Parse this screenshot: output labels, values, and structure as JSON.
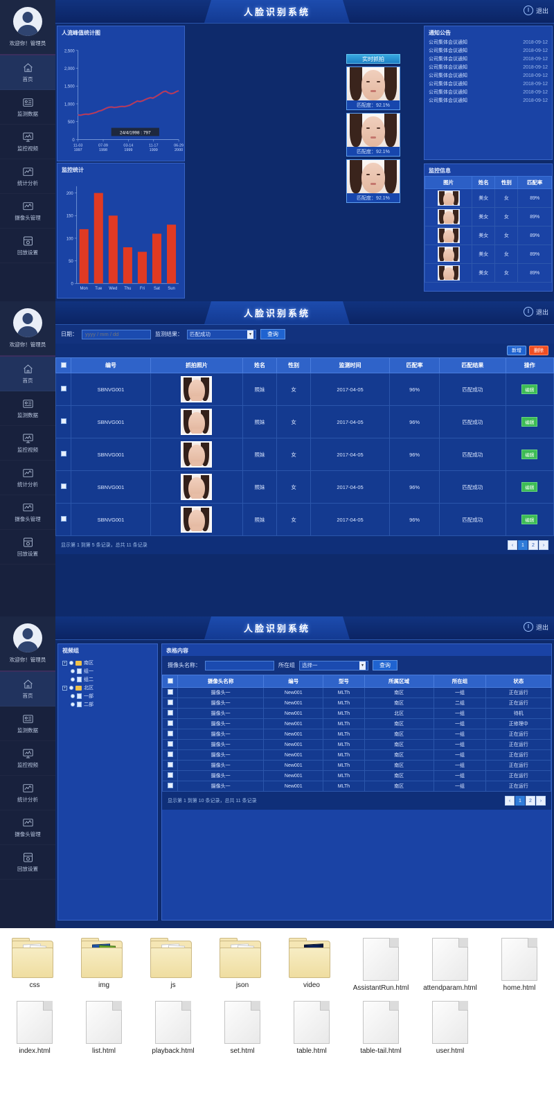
{
  "app": {
    "title": "人脸识别系统",
    "logout_label": "退出"
  },
  "sidebar": {
    "welcome": "欢迎你！管理员",
    "items": [
      {
        "label": "首页",
        "icon": "home-icon"
      },
      {
        "label": "监测数据",
        "icon": "data-monitor-icon"
      },
      {
        "label": "监控视频",
        "icon": "video-monitor-icon"
      },
      {
        "label": "统计分析",
        "icon": "statistics-icon"
      },
      {
        "label": "摄像头管理",
        "icon": "camera-manage-icon"
      },
      {
        "label": "回放设置",
        "icon": "playback-settings-icon"
      }
    ]
  },
  "dashboard": {
    "live": {
      "header": "实时抓拍",
      "cards": [
        {
          "match": "匹配度：92.1%"
        },
        {
          "match": "匹配度：92.1%"
        },
        {
          "match": "匹配度：92.1%"
        }
      ]
    },
    "notice": {
      "title": "通知公告",
      "rows": [
        {
          "text": "公司集体会议通知",
          "date": "2018-09-12"
        },
        {
          "text": "公司集体会议通知",
          "date": "2018-09-12"
        },
        {
          "text": "公司集体会议通知",
          "date": "2018-09-12"
        },
        {
          "text": "公司集体会议通知",
          "date": "2018-09-12"
        },
        {
          "text": "公司集体会议通知",
          "date": "2018-09-12"
        },
        {
          "text": "公司集体会议通知",
          "date": "2018-09-12"
        },
        {
          "text": "公司集体会议通知",
          "date": "2018-09-12"
        },
        {
          "text": "公司集体会议通知",
          "date": "2018-09-12"
        }
      ]
    },
    "monitor": {
      "title": "监控信息",
      "columns": [
        "图片",
        "姓名",
        "性别",
        "匹配率"
      ],
      "rows": [
        {
          "name": "美女",
          "gender": "女",
          "rate": "89%"
        },
        {
          "name": "美女",
          "gender": "女",
          "rate": "89%"
        },
        {
          "name": "美女",
          "gender": "女",
          "rate": "89%"
        },
        {
          "name": "美女",
          "gender": "女",
          "rate": "89%"
        },
        {
          "name": "美女",
          "gender": "女",
          "rate": "89%"
        }
      ]
    }
  },
  "chart_data": [
    {
      "type": "line",
      "title": "人流峰值统计图",
      "xlabel": "",
      "ylabel": "",
      "ylim": [
        0,
        2500
      ],
      "yticks": [
        0,
        500,
        1000,
        1500,
        2000,
        2500
      ],
      "ytick_labels": [
        "0",
        "500",
        "1,000",
        "1,500",
        "2,000",
        "2,500"
      ],
      "tick_labels": [
        "11-03\n1997",
        "07-09\n1998",
        "03-14\n1999",
        "11-17\n1999",
        "06-29\n2000"
      ],
      "annotation": "24/4/1998 : 797",
      "grid": false,
      "color": "#d93b2b",
      "x": [
        0,
        1,
        2,
        3,
        4,
        5,
        6,
        7,
        8,
        9,
        10,
        11,
        12,
        13,
        14,
        15,
        16,
        17,
        18,
        19,
        20,
        21,
        22,
        23,
        24,
        25,
        26,
        27,
        28,
        29,
        30,
        31,
        32,
        33,
        34,
        35,
        36,
        37,
        38,
        39
      ],
      "values": [
        690,
        682,
        700,
        712,
        705,
        722,
        740,
        760,
        797,
        812,
        845,
        880,
        905,
        912,
        898,
        905,
        920,
        930,
        922,
        940,
        960,
        1000,
        1040,
        1080,
        1065,
        1085,
        1120,
        1150,
        1175,
        1160,
        1200,
        1245,
        1290,
        1340,
        1355,
        1310,
        1285,
        1300,
        1340,
        1370
      ]
    },
    {
      "type": "bar",
      "title": "监控统计",
      "categories": [
        "Mon",
        "Tue",
        "Wed",
        "Thu",
        "Fri",
        "Sat",
        "Sun"
      ],
      "values": [
        120,
        200,
        150,
        80,
        70,
        110,
        130
      ],
      "ylim": [
        0,
        215
      ],
      "yticks": [
        0,
        50,
        100,
        150,
        200
      ],
      "ytick_labels": [
        "0",
        "50",
        "100",
        "150",
        "200"
      ],
      "xlabel": "",
      "ylabel": "",
      "grid": false,
      "color": "#e03a23"
    }
  ],
  "records": {
    "filters": {
      "date_label": "日期：",
      "date_placeholder": "yyyy / mm / dd",
      "date_value": "",
      "result_label": "监测结果：",
      "result_value": "匹配成功",
      "query_label": "查询"
    },
    "actions": {
      "new_label": "新增",
      "delete_label": "删除"
    },
    "columns": [
      "",
      "编号",
      "抓拍照片",
      "姓名",
      "性别",
      "监测时间",
      "匹配率",
      "匹配结果",
      "操作"
    ],
    "rows": [
      {
        "id": "SBNVG001",
        "name": "照妹",
        "gender": "女",
        "time": "2017-04-05",
        "rate": "96%",
        "result": "匹配成功",
        "op": "编辑"
      },
      {
        "id": "SBNVG001",
        "name": "照妹",
        "gender": "女",
        "time": "2017-04-05",
        "rate": "96%",
        "result": "匹配成功",
        "op": "编辑"
      },
      {
        "id": "SBNVG001",
        "name": "照妹",
        "gender": "女",
        "time": "2017-04-05",
        "rate": "96%",
        "result": "匹配成功",
        "op": "编辑"
      },
      {
        "id": "SBNVG001",
        "name": "照妹",
        "gender": "女",
        "time": "2017-04-05",
        "rate": "96%",
        "result": "匹配成功",
        "op": "编辑"
      },
      {
        "id": "SBNVG001",
        "name": "照妹",
        "gender": "女",
        "time": "2017-04-05",
        "rate": "96%",
        "result": "匹配成功",
        "op": "编辑"
      }
    ],
    "footer_text": "显示第 1 到第 5 条记录，总共 11 条记录",
    "pager": {
      "prev": "‹",
      "pages": [
        "1",
        "2"
      ],
      "next": "›",
      "active": "1"
    }
  },
  "cameras": {
    "tree_title": "视频组",
    "tree": [
      {
        "label": "南区",
        "level": 0,
        "type": "folder"
      },
      {
        "label": "组一",
        "level": 1,
        "type": "file"
      },
      {
        "label": "组二",
        "level": 1,
        "type": "file"
      },
      {
        "label": "北区",
        "level": 0,
        "type": "folder"
      },
      {
        "label": "一部",
        "level": 1,
        "type": "file"
      },
      {
        "label": "二部",
        "level": 1,
        "type": "file"
      }
    ],
    "panel_title": "表格内容",
    "filters": {
      "name_label": "摄像头名称：",
      "name_placeholder": "",
      "name_value": "",
      "group_label": "所在组",
      "group_value": "选择一",
      "query_label": "查询"
    },
    "columns": [
      "",
      "摄像头名称",
      "编号",
      "型号",
      "所属区域",
      "所在组",
      "状态"
    ],
    "rows": [
      {
        "name": "摄像头一",
        "code": "New001",
        "model": "MLTh",
        "area": "南区",
        "group": "一组",
        "status": "正在运行"
      },
      {
        "name": "摄像头一",
        "code": "New001",
        "model": "MLTh",
        "area": "南区",
        "group": "二组",
        "status": "正在运行"
      },
      {
        "name": "摄像头一",
        "code": "New001",
        "model": "MLTh",
        "area": "北区",
        "group": "一组",
        "status": "待机"
      },
      {
        "name": "摄像头一",
        "code": "New001",
        "model": "MLTh",
        "area": "南区",
        "group": "一组",
        "status": "正修理中"
      },
      {
        "name": "摄像头一",
        "code": "New001",
        "model": "MLTh",
        "area": "南区",
        "group": "一组",
        "status": "正在运行"
      },
      {
        "name": "摄像头一",
        "code": "New001",
        "model": "MLTh",
        "area": "南区",
        "group": "一组",
        "status": "正在运行"
      },
      {
        "name": "摄像头一",
        "code": "New001",
        "model": "MLTh",
        "area": "南区",
        "group": "一组",
        "status": "正在运行"
      },
      {
        "name": "摄像头一",
        "code": "New001",
        "model": "MLTh",
        "area": "南区",
        "group": "一组",
        "status": "正在运行"
      },
      {
        "name": "摄像头一",
        "code": "New001",
        "model": "MLTh",
        "area": "南区",
        "group": "一组",
        "status": "正在运行"
      },
      {
        "name": "摄像头一",
        "code": "New001",
        "model": "MLTh",
        "area": "南区",
        "group": "一组",
        "status": "正在运行"
      }
    ],
    "footer_text": "显示第 1 到第 10 条记录，总共 11 条记录",
    "pager": {
      "prev": "‹",
      "pages": [
        "1",
        "2"
      ],
      "next": "›",
      "active": "1"
    }
  },
  "files": {
    "row1": [
      {
        "label": "css",
        "kind": "folder",
        "variant": "plain"
      },
      {
        "label": "img",
        "kind": "folder",
        "variant": "images"
      },
      {
        "label": "js",
        "kind": "folder",
        "variant": "plain"
      },
      {
        "label": "json",
        "kind": "folder",
        "variant": "multi"
      },
      {
        "label": "video",
        "kind": "folder",
        "variant": "video"
      },
      {
        "label": "AssistantRun.html",
        "kind": "doc"
      },
      {
        "label": "attendparam.html",
        "kind": "doc"
      },
      {
        "label": "home.html",
        "kind": "doc"
      }
    ],
    "row2": [
      {
        "label": "index.html",
        "kind": "doc"
      },
      {
        "label": "list.html",
        "kind": "doc"
      },
      {
        "label": "playback.html",
        "kind": "doc"
      },
      {
        "label": "set.html",
        "kind": "doc"
      },
      {
        "label": "table.html",
        "kind": "doc"
      },
      {
        "label": "table-tail.html",
        "kind": "doc"
      },
      {
        "label": "user.html",
        "kind": "doc"
      }
    ]
  },
  "colors": {
    "bg_dark": "#0e2a6b",
    "panel": "#1a43a5",
    "accent": "#2f7bd8",
    "danger": "#f04e23",
    "success": "#3dbb55",
    "chart_red": "#d93b2b"
  }
}
